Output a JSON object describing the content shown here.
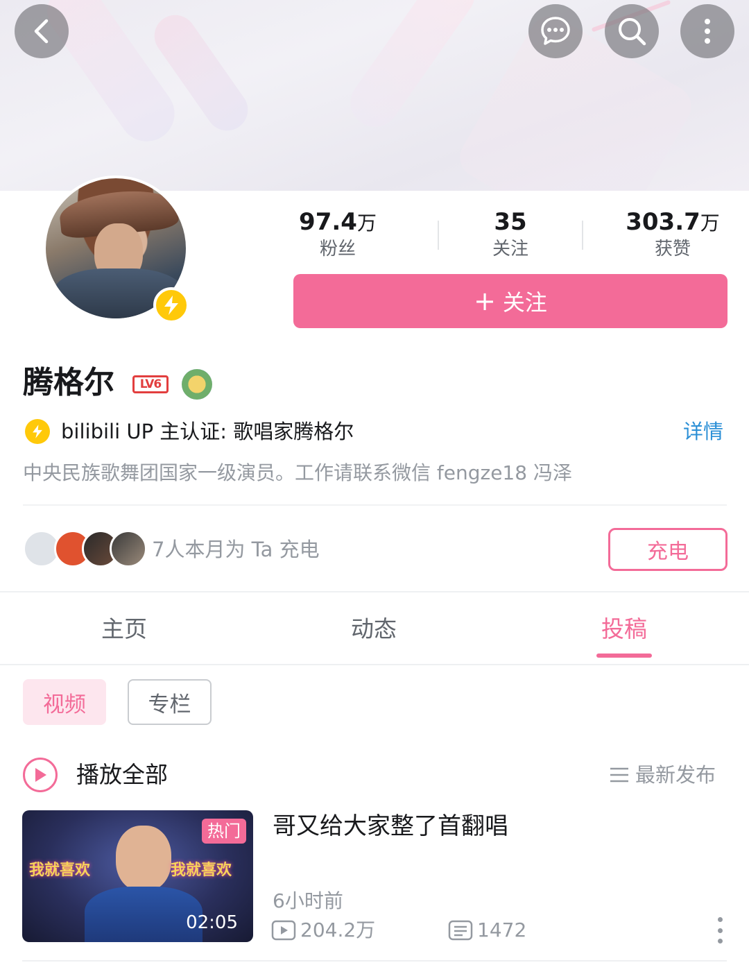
{
  "stats": {
    "fans": {
      "value": "97.4",
      "unit": "万",
      "label": "粉丝"
    },
    "following": {
      "value": "35",
      "unit": "",
      "label": "关注"
    },
    "likes": {
      "value": "303.7",
      "unit": "万",
      "label": "获赞"
    }
  },
  "follow_button": {
    "plus": "+",
    "label": "关注"
  },
  "profile": {
    "name": "腾格尔",
    "level": "LV6",
    "certification": "bilibili UP 主认证: 歌唱家腾格尔",
    "detail_link": "详情",
    "bio": "中央民族歌舞团国家一级演员。工作请联系微信 fengze18 冯泽"
  },
  "charge": {
    "text": "7人本月为 Ta 充电",
    "button": "充电"
  },
  "tabs": [
    {
      "label": "主页",
      "active": false
    },
    {
      "label": "动态",
      "active": false
    },
    {
      "label": "投稿",
      "active": true
    }
  ],
  "filters": {
    "video": "视频",
    "column": "专栏"
  },
  "playlist": {
    "play_all": "播放全部",
    "sort": "最新发布"
  },
  "video": {
    "badge": "热门",
    "duration": "02:05",
    "title": "哥又给大家整了首翻唱",
    "time": "6小时前",
    "views": "204.2万",
    "danmaku": "1472",
    "thumb_text_left": "我就喜欢",
    "thumb_text_right": "我就喜欢"
  },
  "colors": {
    "accent": "#f36b98",
    "link": "#2b8fd6",
    "badge_yellow": "#ffc90a"
  }
}
